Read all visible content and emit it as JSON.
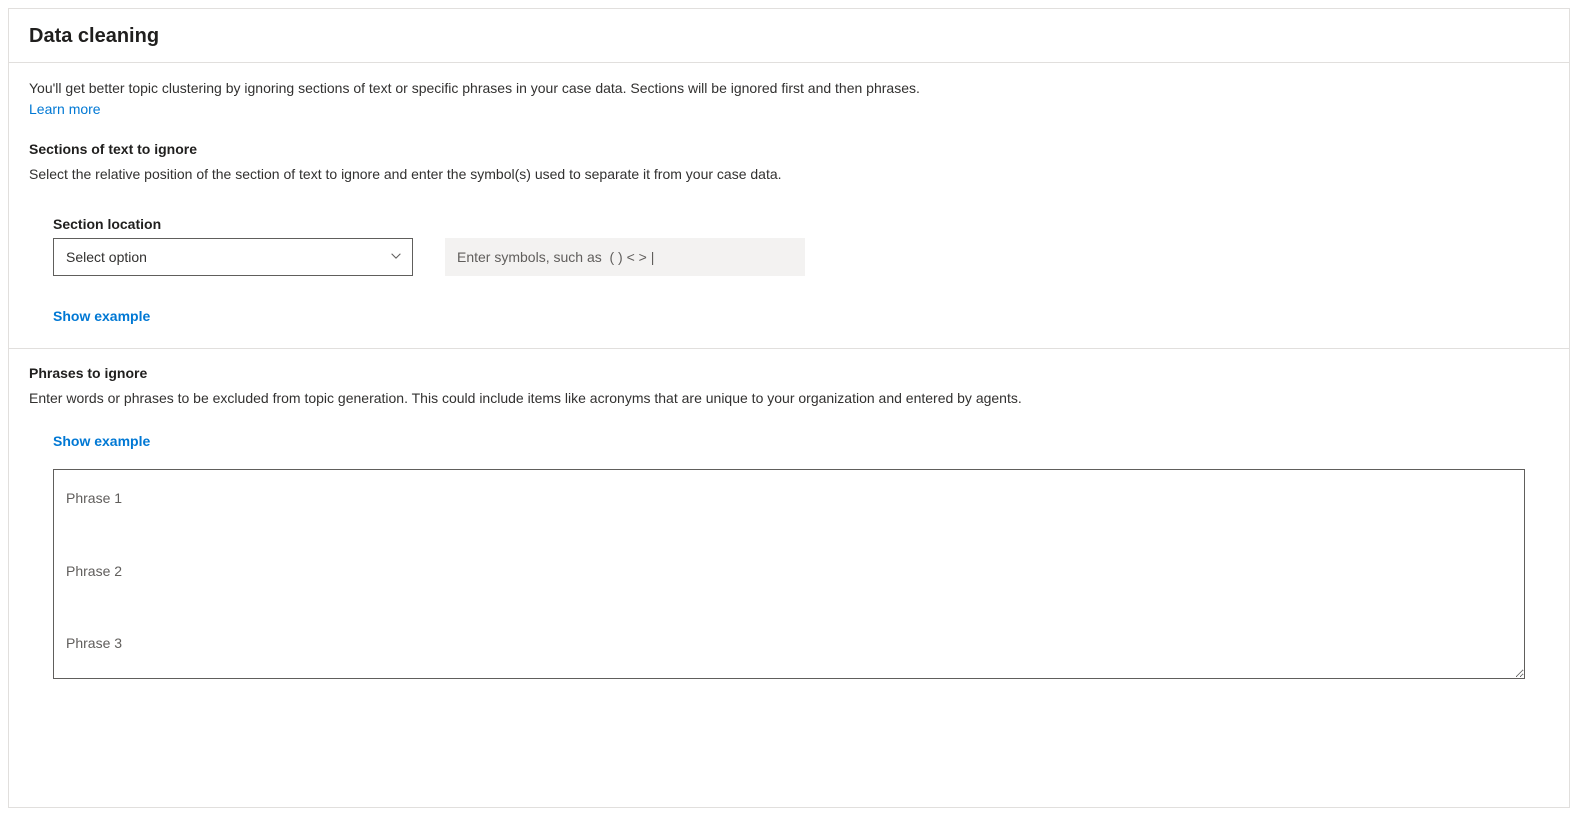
{
  "header": {
    "title": "Data cleaning"
  },
  "intro": {
    "text": "You'll get better topic clustering by ignoring sections of text or specific phrases in your case data. Sections will be ignored first and then phrases.",
    "learn_more": "Learn more"
  },
  "sections": {
    "title": "Sections of text to ignore",
    "description": "Select the relative position of the section of text to ignore and enter the symbol(s) used to separate it from your case data.",
    "location_label": "Section location",
    "select_placeholder": "Select option",
    "symbols_placeholder": "Enter symbols, such as  ( ) < > |",
    "show_example": "Show example"
  },
  "phrases": {
    "title": "Phrases to ignore",
    "description": "Enter words or phrases to be excluded from topic generation. This could include items like acronyms that are unique to your organization and entered by agents.",
    "show_example": "Show example",
    "textarea_placeholder": "Phrase 1\n\nPhrase 2\n\nPhrase 3"
  }
}
